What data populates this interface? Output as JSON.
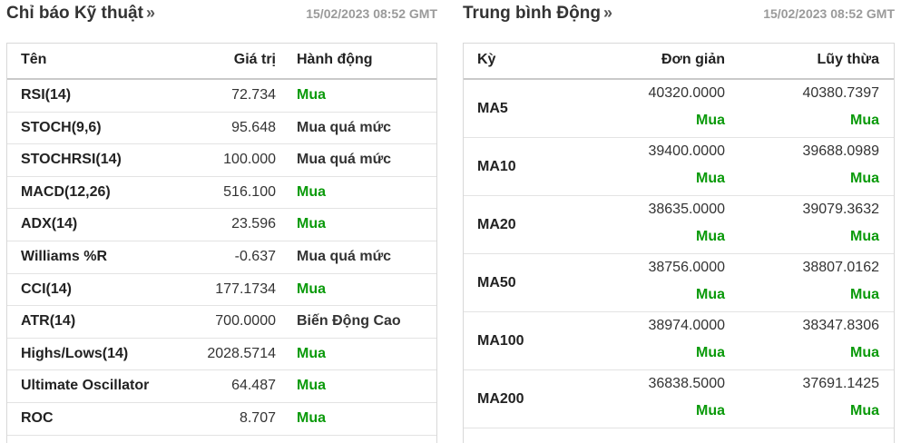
{
  "colors": {
    "buy": "#0a9a0a",
    "neutral": "#333333",
    "time": "#9a9a9a"
  },
  "technical": {
    "title": "Chỉ báo Kỹ thuật",
    "arrow": "»",
    "timestamp": "15/02/2023 08:52 GMT",
    "headers": {
      "name": "Tên",
      "value": "Giá trị",
      "action": "Hành động"
    },
    "rows": [
      {
        "name": "RSI(14)",
        "value": "72.734",
        "action": "Mua",
        "buy": true
      },
      {
        "name": "STOCH(9,6)",
        "value": "95.648",
        "action": "Mua quá mức",
        "buy": false
      },
      {
        "name": "STOCHRSI(14)",
        "value": "100.000",
        "action": "Mua quá mức",
        "buy": false
      },
      {
        "name": "MACD(12,26)",
        "value": "516.100",
        "action": "Mua",
        "buy": true
      },
      {
        "name": "ADX(14)",
        "value": "23.596",
        "action": "Mua",
        "buy": true
      },
      {
        "name": "Williams %R",
        "value": "-0.637",
        "action": "Mua quá mức",
        "buy": false
      },
      {
        "name": "CCI(14)",
        "value": "177.1734",
        "action": "Mua",
        "buy": true
      },
      {
        "name": "ATR(14)",
        "value": "700.0000",
        "action": "Biến Động Cao",
        "buy": false
      },
      {
        "name": "Highs/Lows(14)",
        "value": "2028.5714",
        "action": "Mua",
        "buy": true
      },
      {
        "name": "Ultimate Oscillator",
        "value": "64.487",
        "action": "Mua",
        "buy": true
      },
      {
        "name": "ROC",
        "value": "8.707",
        "action": "Mua",
        "buy": true
      }
    ]
  },
  "moving_averages": {
    "title": "Trung bình Động",
    "arrow": "»",
    "timestamp": "15/02/2023 08:52 GMT",
    "headers": {
      "period": "Kỳ",
      "simple": "Đơn giản",
      "exponential": "Lũy thừa"
    },
    "rows": [
      {
        "period": "MA5",
        "simple": "40320.0000",
        "simple_action": "Mua",
        "exponential": "40380.7397",
        "exponential_action": "Mua"
      },
      {
        "period": "MA10",
        "simple": "39400.0000",
        "simple_action": "Mua",
        "exponential": "39688.0989",
        "exponential_action": "Mua"
      },
      {
        "period": "MA20",
        "simple": "38635.0000",
        "simple_action": "Mua",
        "exponential": "39079.3632",
        "exponential_action": "Mua"
      },
      {
        "period": "MA50",
        "simple": "38756.0000",
        "simple_action": "Mua",
        "exponential": "38807.0162",
        "exponential_action": "Mua"
      },
      {
        "period": "MA100",
        "simple": "38974.0000",
        "simple_action": "Mua",
        "exponential": "38347.8306",
        "exponential_action": "Mua"
      },
      {
        "period": "MA200",
        "simple": "36838.5000",
        "simple_action": "Mua",
        "exponential": "37691.1425",
        "exponential_action": "Mua"
      }
    ]
  }
}
